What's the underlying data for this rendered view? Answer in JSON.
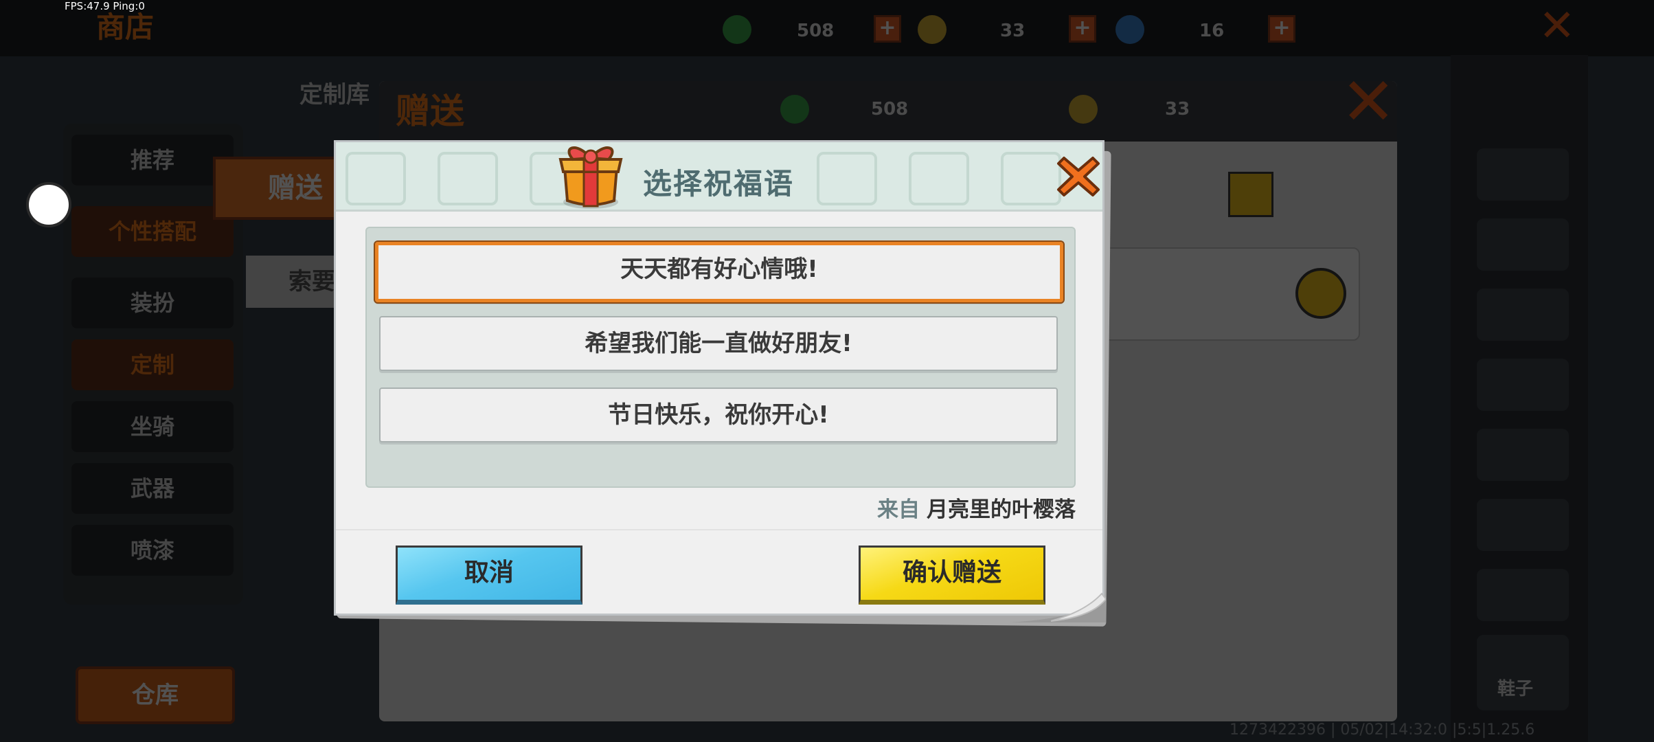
{
  "overlay": {
    "fps_text": "FPS:47.9  Ping:0"
  },
  "background": {
    "shop_title": "商店",
    "resources": [
      {
        "icon": "green-gem-icon",
        "value": "508"
      },
      {
        "icon": "gold-coin-icon",
        "value": "33"
      },
      {
        "icon": "blue-gem-icon",
        "value": "16"
      }
    ],
    "custom_lib_tab": "定制库",
    "categories": [
      "推荐",
      "个性搭配",
      "装扮",
      "定制",
      "坐骑",
      "武器",
      "喷漆"
    ],
    "warehouse_label": "仓库",
    "gift_panel": {
      "title": "赠送",
      "green_gem_value": "508",
      "gold_coin_value": "33",
      "tab_gift": "赠送",
      "tab_request": "索要"
    },
    "shoes_label": "鞋子",
    "bottom_meta": "1273422396 | 05/02|14:32:0 |5:5|1.25.6"
  },
  "dialog": {
    "title": "选择祝福语",
    "messages": [
      {
        "text": "天天都有好心情哦!",
        "selected": true
      },
      {
        "text": "希望我们能一直做好朋友!",
        "selected": false
      },
      {
        "text": "节日快乐，祝你开心!",
        "selected": false
      }
    ],
    "from_label": "来自",
    "from_name": "月亮里的叶樱落",
    "cancel_label": "取消",
    "confirm_label": "确认赠送"
  },
  "colors": {
    "accent_orange": "#e98324",
    "cancel_blue": "#56c6ef",
    "confirm_yellow": "#f6d916",
    "title_teal": "#4f6c70"
  }
}
